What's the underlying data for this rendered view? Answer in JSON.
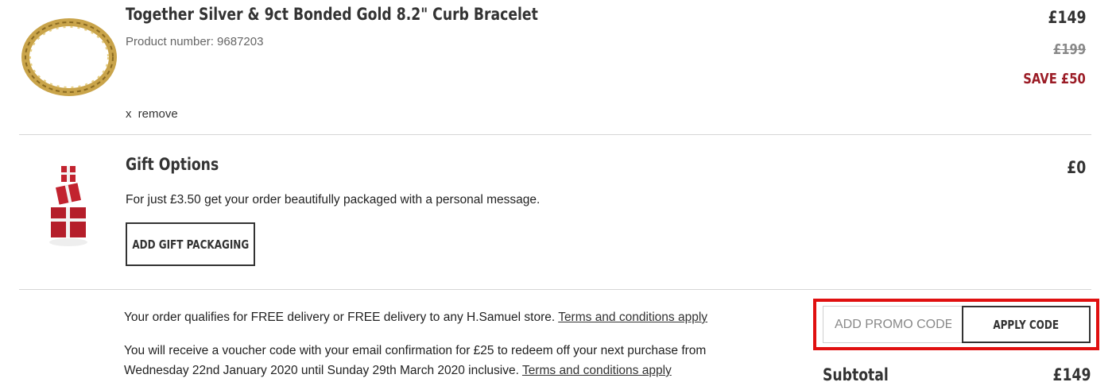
{
  "product": {
    "title": "Together Silver & 9ct Bonded Gold 8.2\" Curb Bracelet",
    "product_number": "Product number: 9687203",
    "price": "£149",
    "old_price": "£199",
    "save": "SAVE £50",
    "remove_x": "x",
    "remove_label": "remove"
  },
  "gift": {
    "title": "Gift Options",
    "price": "£0",
    "description": "For just £3.50 get your order beautifully packaged with a personal message.",
    "button_label": "ADD GIFT PACKAGING"
  },
  "delivery": {
    "line1": "Your order qualifies for FREE delivery or FREE delivery to any H.Samuel store.",
    "terms1": "Terms and conditions apply",
    "line2": "You will receive a voucher code with your email confirmation for £25 to redeem off your next purchase from",
    "line3": "Wednesday 22nd January 2020 until Sunday 29th March 2020 inclusive.",
    "terms2": "Terms and conditions apply"
  },
  "promo": {
    "placeholder": "ADD PROMO CODE",
    "apply_label": "APPLY CODE"
  },
  "summary": {
    "subtotal_label": "Subtotal",
    "subtotal_value": "£149"
  },
  "colors": {
    "accent_red": "#9b1c26",
    "highlight": "#e01010"
  }
}
